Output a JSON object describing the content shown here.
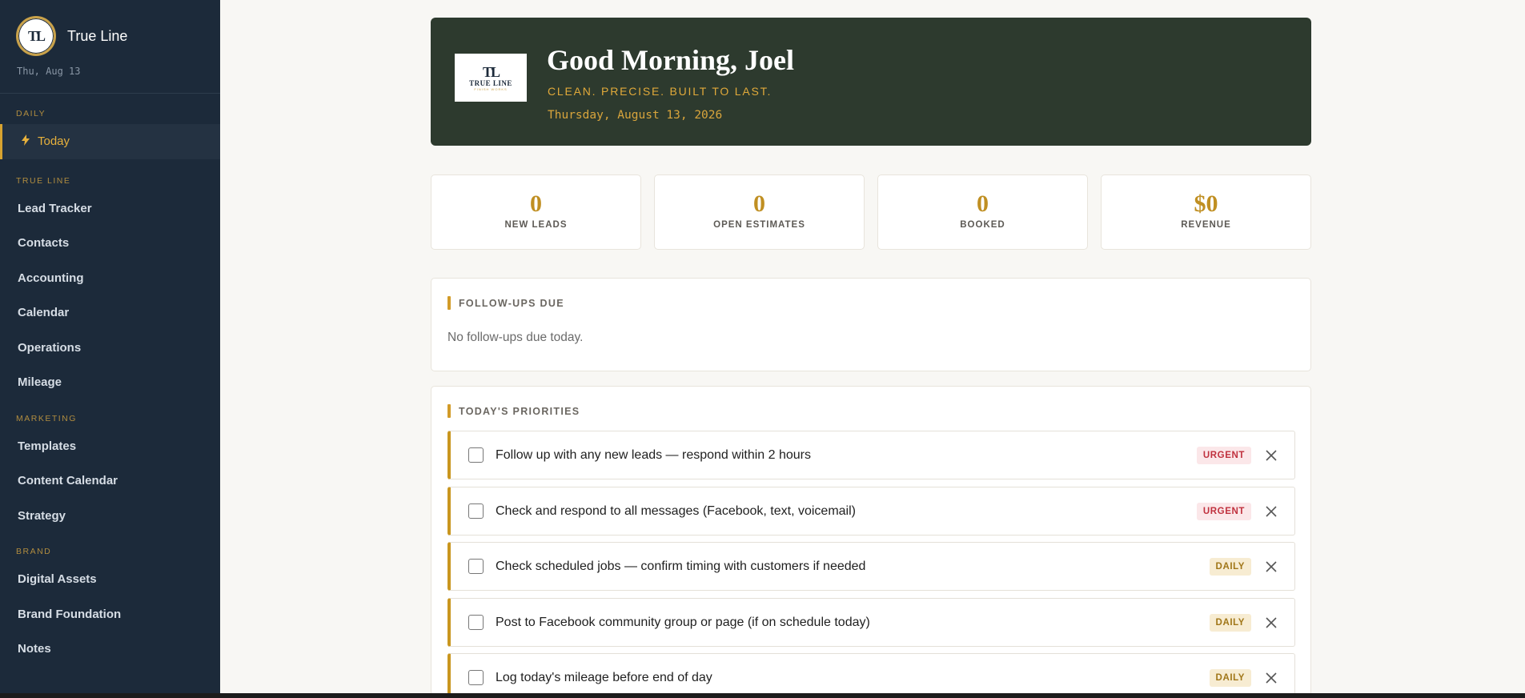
{
  "sidebar": {
    "app_name": "True Line",
    "logo_monogram": "TL",
    "date": "Thu, Aug 13",
    "sections": [
      {
        "label": "DAILY",
        "items": [
          {
            "label": "Today",
            "icon": "bolt-icon",
            "active": true
          }
        ]
      },
      {
        "label": "TRUE LINE",
        "items": [
          {
            "label": "Lead Tracker"
          },
          {
            "label": "Contacts"
          },
          {
            "label": "Accounting"
          },
          {
            "label": "Calendar"
          },
          {
            "label": "Operations"
          },
          {
            "label": "Mileage"
          }
        ]
      },
      {
        "label": "MARKETING",
        "items": [
          {
            "label": "Templates"
          },
          {
            "label": "Content Calendar"
          },
          {
            "label": "Strategy"
          }
        ]
      },
      {
        "label": "BRAND",
        "items": [
          {
            "label": "Digital Assets"
          },
          {
            "label": "Brand Foundation"
          },
          {
            "label": "Notes"
          }
        ]
      }
    ]
  },
  "hero": {
    "logo_monogram": "TL",
    "logo_word": "TRUE LINE",
    "logo_sub": "FINISH WORKS",
    "title": "Good Morning, Joel",
    "tagline": "CLEAN. PRECISE. BUILT TO LAST.",
    "date": "Thursday, August 13, 2026"
  },
  "stats": [
    {
      "value": "0",
      "label": "NEW LEADS"
    },
    {
      "value": "0",
      "label": "OPEN ESTIMATES"
    },
    {
      "value": "0",
      "label": "BOOKED"
    },
    {
      "value": "$0",
      "label": "REVENUE"
    }
  ],
  "followups": {
    "title": "FOLLOW-UPS DUE",
    "empty_text": "No follow-ups due today."
  },
  "priorities": {
    "title": "TODAY'S PRIORITIES",
    "tasks": [
      {
        "text": "Follow up with any new leads — respond within 2 hours",
        "badge": "URGENT",
        "badge_type": "urgent"
      },
      {
        "text": "Check and respond to all messages (Facebook, text, voicemail)",
        "badge": "URGENT",
        "badge_type": "urgent"
      },
      {
        "text": "Check scheduled jobs — confirm timing with customers if needed",
        "badge": "DAILY",
        "badge_type": "daily"
      },
      {
        "text": "Post to Facebook community group or page (if on schedule today)",
        "badge": "DAILY",
        "badge_type": "daily"
      },
      {
        "text": "Log today's mileage before end of day",
        "badge": "DAILY",
        "badge_type": "daily"
      }
    ]
  },
  "colors": {
    "sidebar_bg": "#1c2a3a",
    "hero_bg": "#2d3a2e",
    "accent_gold": "#c9961f",
    "urgent": "#c0313e",
    "daily": "#a07618"
  }
}
